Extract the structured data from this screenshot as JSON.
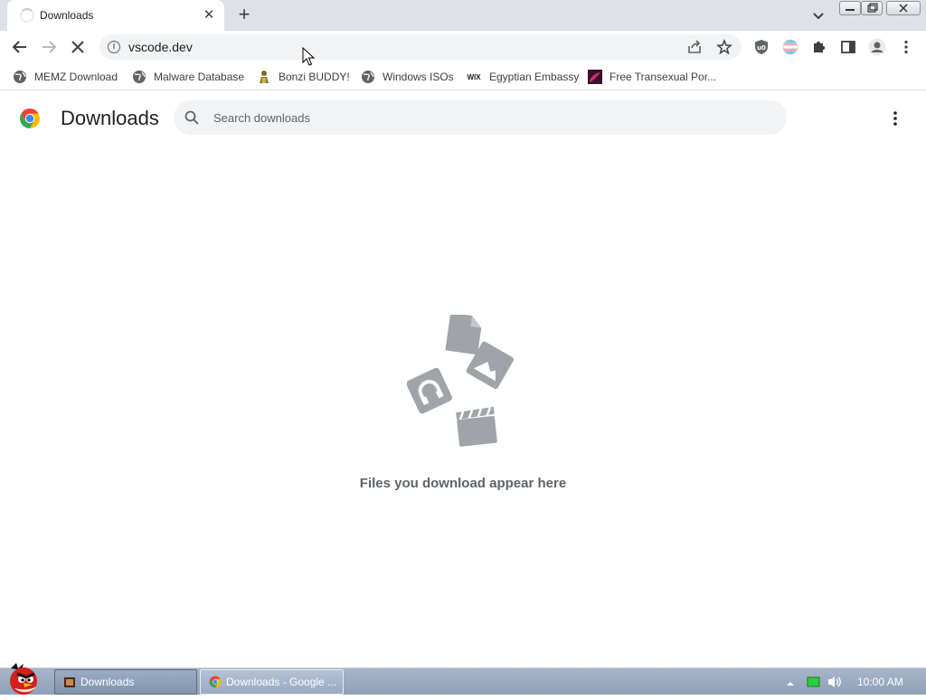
{
  "tab": {
    "title": "Downloads",
    "close_glyph": "✕"
  },
  "new_tab_glyph": "+",
  "toolbar": {
    "url": "vscode.dev",
    "info_glyph": "i"
  },
  "bookmarks": [
    {
      "label": "MEMZ Download",
      "icon": "globe-icon"
    },
    {
      "label": "Malware Database",
      "icon": "globe-icon"
    },
    {
      "label": "Bonzi BUDDY!",
      "icon": "bonzi-icon"
    },
    {
      "label": "Windows ISOs",
      "icon": "globe-icon"
    },
    {
      "label": "Egyptian Embassy",
      "icon": "wix-icon",
      "icon_text": "WIX"
    },
    {
      "label": "Free Transexual Por...",
      "icon": "site-favicon"
    }
  ],
  "downloads_page": {
    "title": "Downloads",
    "search_placeholder": "Search downloads",
    "empty_message": "Files you download appear here"
  },
  "taskbar": {
    "tasks": [
      {
        "label": "Downloads"
      },
      {
        "label": "Downloads - Google ..."
      }
    ],
    "clock": "10:00 AM"
  },
  "colors": {
    "tabstrip": "#dee1e6",
    "omnibox": "#f1f3f4",
    "empty_art": "#a0a4a9",
    "taskbar": "#8ea0b8"
  }
}
